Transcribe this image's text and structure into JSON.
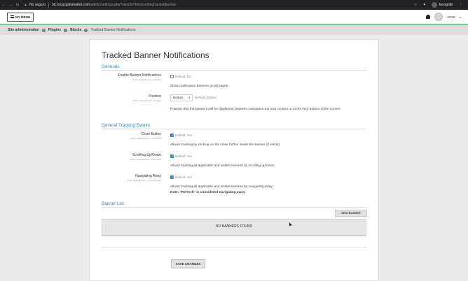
{
  "browser": {
    "security_label": "No seguro",
    "url_host": "olc.local.getsmarter.com",
    "url_path": "/admin/settings.php?section=blocksettingtrackedbanner",
    "incognito_label": "Incognito"
  },
  "navbar": {
    "menu_label": "MY MENU",
    "user_name": "JOSE"
  },
  "breadcrumb": {
    "items": [
      "Site administration",
      "Plugins",
      "Blocks"
    ],
    "current": "Tracked Banner Notifications"
  },
  "page": {
    "title": "Tracked Banner Notifications"
  },
  "sections": {
    "generals": "Generals",
    "tracking": "General Tracking Events",
    "banner_list": "Banner List"
  },
  "settings": {
    "enable": {
      "label": "Enable Banner Notifications",
      "sub": "block_trackedbanner | enabled",
      "default": "Default: No",
      "checked": false,
      "desc": "Show notification banners on all pages."
    },
    "position": {
      "label": "Position",
      "sub": "block_trackedbanner | position",
      "value": "Bottom",
      "default": "Default: Bottom",
      "desc": "Position that the banners will be displayed; between navigation bar and content or at the very bottom of the screen."
    },
    "close": {
      "label": "Close Button",
      "sub": "block_trackedbanner | eventclick",
      "default": "Default: Yes",
      "checked": true,
      "desc": "Allows tracking by clicking on the close button inside the banner (if exists)."
    },
    "scroll": {
      "label": "Scrolling Up/Down",
      "sub": "block_trackedbanner | eventscroll",
      "default": "Default: Yes",
      "checked": true,
      "desc": "Allows tracking all applicable and visible banners by scrolling up/down."
    },
    "away": {
      "label": "Navigating Away",
      "sub": "block_trackedbanner | eventnavigate",
      "default": "Default: Yes",
      "checked": true,
      "desc": "Allows tracking all applicable and visible banners by navigating away.",
      "note": "Note: \"Refresh\" is considered navigating away."
    }
  },
  "banner_list": {
    "new_button": "NEW BANNER",
    "empty_text": "NO BANNERS FOUND"
  },
  "save_label": "SAVE CHANGES",
  "colors": {
    "accent": "#2f88c8",
    "navbar_strip": "#6fcf97"
  }
}
